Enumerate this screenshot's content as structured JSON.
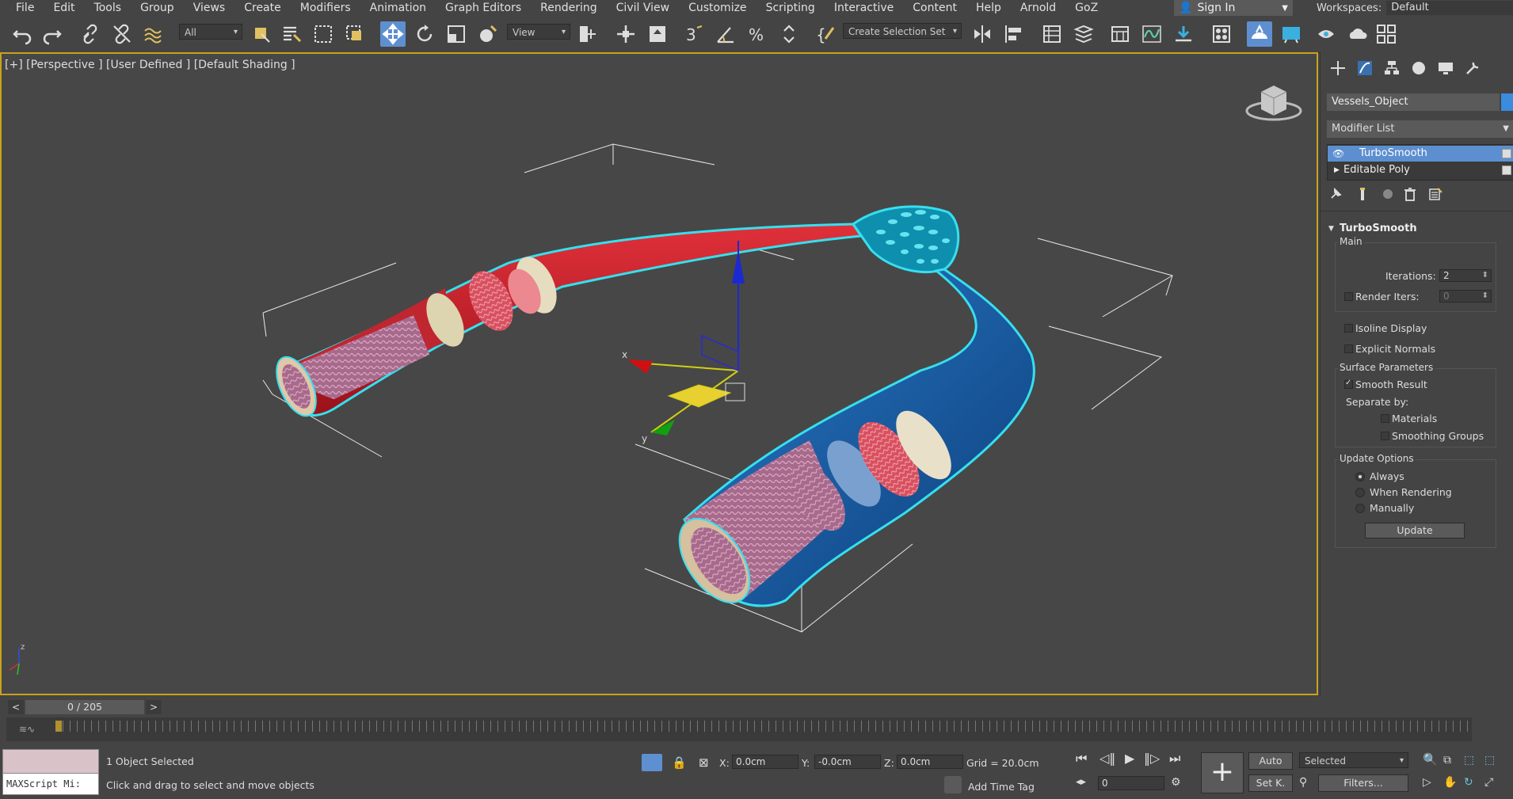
{
  "menu": [
    "File",
    "Edit",
    "Tools",
    "Group",
    "Views",
    "Create",
    "Modifiers",
    "Animation",
    "Graph Editors",
    "Rendering",
    "Civil View",
    "Customize",
    "Scripting",
    "Interactive",
    "Content",
    "Help",
    "Arnold",
    "GoZ"
  ],
  "signin": {
    "label": "Sign In"
  },
  "workspaces": {
    "label": "Workspaces:",
    "value": "Default"
  },
  "toolbar": {
    "filter_value": "All",
    "coord_system": "View",
    "selection_set_placeholder": "Create Selection Set",
    "snap_label": "3"
  },
  "viewport": {
    "label": "[+] [Perspective ] [User Defined ] [Default Shading ]",
    "gizmo_x": "x",
    "gizmo_y": "y",
    "axis_z": "z"
  },
  "panel": {
    "object_name": "Vessels_Object",
    "object_color": "#3b8bde",
    "modifier_list": "Modifier List",
    "stack": [
      "TurboSmooth",
      "Editable Poly"
    ],
    "rollout_title": "TurboSmooth",
    "main_group": "Main",
    "iterations_label": "Iterations:",
    "iterations_value": "2",
    "render_iters_label": "Render Iters:",
    "render_iters_value": "0",
    "isoline_label": "Isoline Display",
    "explicit_normals_label": "Explicit Normals",
    "surface_group": "Surface Parameters",
    "smooth_result_label": "Smooth Result",
    "separate_by_label": "Separate by:",
    "materials_label": "Materials",
    "smoothing_groups_label": "Smoothing Groups",
    "update_group": "Update Options",
    "always_label": "Always",
    "when_rendering_label": "When Rendering",
    "manually_label": "Manually",
    "update_button": "Update"
  },
  "timeline": {
    "frame": "0 / 205",
    "prev": "<",
    "next": ">"
  },
  "status": {
    "listener": "MAXScript Mi:",
    "selected": "1 Object Selected",
    "prompt": "Click and drag to select and move objects",
    "x_label": "X:",
    "x_value": "0.0cm",
    "y_label": "Y:",
    "y_value": "-0.0cm",
    "z_label": "Z:",
    "z_value": "0.0cm",
    "grid": "Grid = 20.0cm",
    "add_time_tag": "Add Time Tag",
    "auto_button": "Auto",
    "setk_button": "Set K.",
    "selected_dropdown": "Selected",
    "filters_button": "Filters...",
    "frame_field": "0"
  },
  "colors": {
    "accent": "#5e8fd1",
    "viewport_border": "#c8a21e",
    "artery": "#c8202a",
    "vein": "#1c64a8",
    "selection": "#35e0ef"
  }
}
